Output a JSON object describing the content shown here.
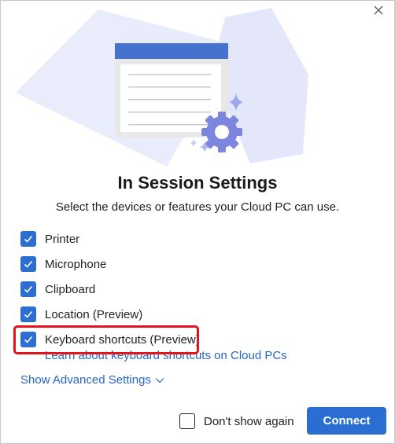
{
  "dialog": {
    "title": "In Session Settings",
    "subtitle": "Select the devices or features your Cloud PC can use."
  },
  "options": [
    {
      "label": "Printer",
      "checked": true
    },
    {
      "label": "Microphone",
      "checked": true
    },
    {
      "label": "Clipboard",
      "checked": true
    },
    {
      "label": "Location (Preview)",
      "checked": true
    },
    {
      "label": "Keyboard shortcuts (Preview)",
      "checked": true
    }
  ],
  "learn_link": "Learn about keyboard shortcuts on Cloud PCs",
  "advanced_link": "Show Advanced Settings",
  "footer": {
    "dont_show_label": "Don't show again",
    "dont_show_checked": false,
    "connect_label": "Connect"
  },
  "icons": {
    "close": "close-icon",
    "checkbox": "checkmark-icon",
    "chevron": "chevron-down-icon",
    "illustration": "settings-window-gear-illustration"
  },
  "colors": {
    "accent": "#2a6ed1",
    "link": "#2966c4",
    "highlight": "#e2141c"
  }
}
